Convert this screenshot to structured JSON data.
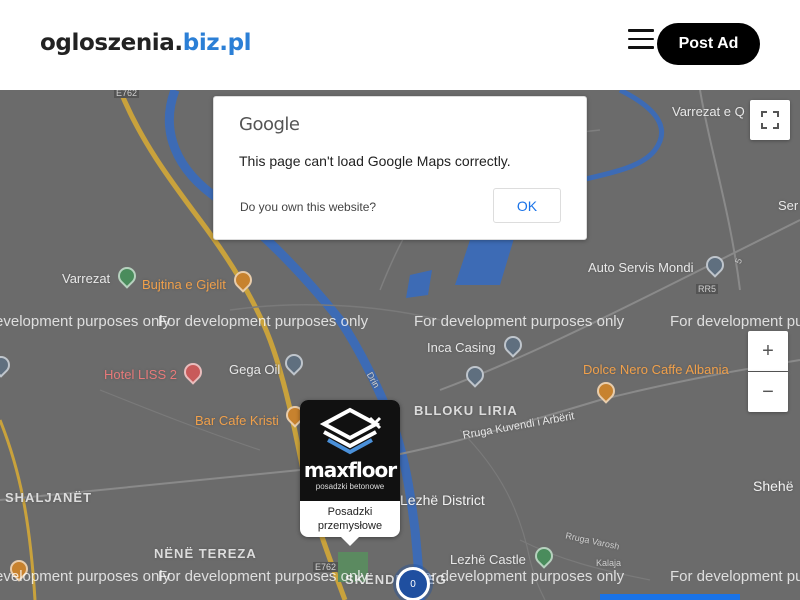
{
  "header": {
    "logo_main": "ogloszenia.",
    "logo_accent": "biz.pl",
    "post_ad_label": "Post Ad"
  },
  "dialog": {
    "google_logo": "Google",
    "message": "This page can't load Google Maps correctly.",
    "own_site": "Do you own this website?",
    "ok_label": "OK"
  },
  "map": {
    "watermark": "For development purposes only",
    "labels": {
      "varrezat_q": "Varrezat e Q",
      "ser": "Ser",
      "auto_servis": "Auto Servis Mondi",
      "varrezat": "Varrezat",
      "bujtina": "Bujtina e Gjelit",
      "inca": "Inca Casing",
      "dolce": "Dolce Nero Caffe Albania",
      "hotel": "Hotel LISS 2",
      "gega": "Gega Oil",
      "blloku": "BLLOKU LIRIA",
      "rruga_kuvendi": "Rruga Kuvendi i Arbërit",
      "bar_cafe": "Bar Cafe Kristi",
      "shaljanet": "SHALJANËT",
      "lezhe_district": "Lezhë District",
      "shehe": "Shehë",
      "nene_tereza": "NËNË TEREZA",
      "lezhe_castle": "Lezhë Castle",
      "rruga_varosh": "Rruga Varosh",
      "kalaja": "Kalaja",
      "skenderbeg": "SKËNDERBEG",
      "e762_top": "E762",
      "e762_bottom": "E762",
      "rr5": "RR5",
      "route5": "5",
      "drin": "Drin"
    },
    "zoom_in": "+",
    "zoom_out": "−",
    "fullscreen_icon": "fullscreen-icon"
  },
  "marker": {
    "brand": "maxfloor",
    "tagline": "posadzki betonowe",
    "caption_line1": "Posadzki",
    "caption_line2": "przemysłowe"
  },
  "cluster": {
    "count": "0"
  },
  "colors": {
    "accent": "#2b7fd6",
    "map_bg": "#6b6b6b",
    "water": "#3d6bb5",
    "primary_button": "#000000"
  }
}
